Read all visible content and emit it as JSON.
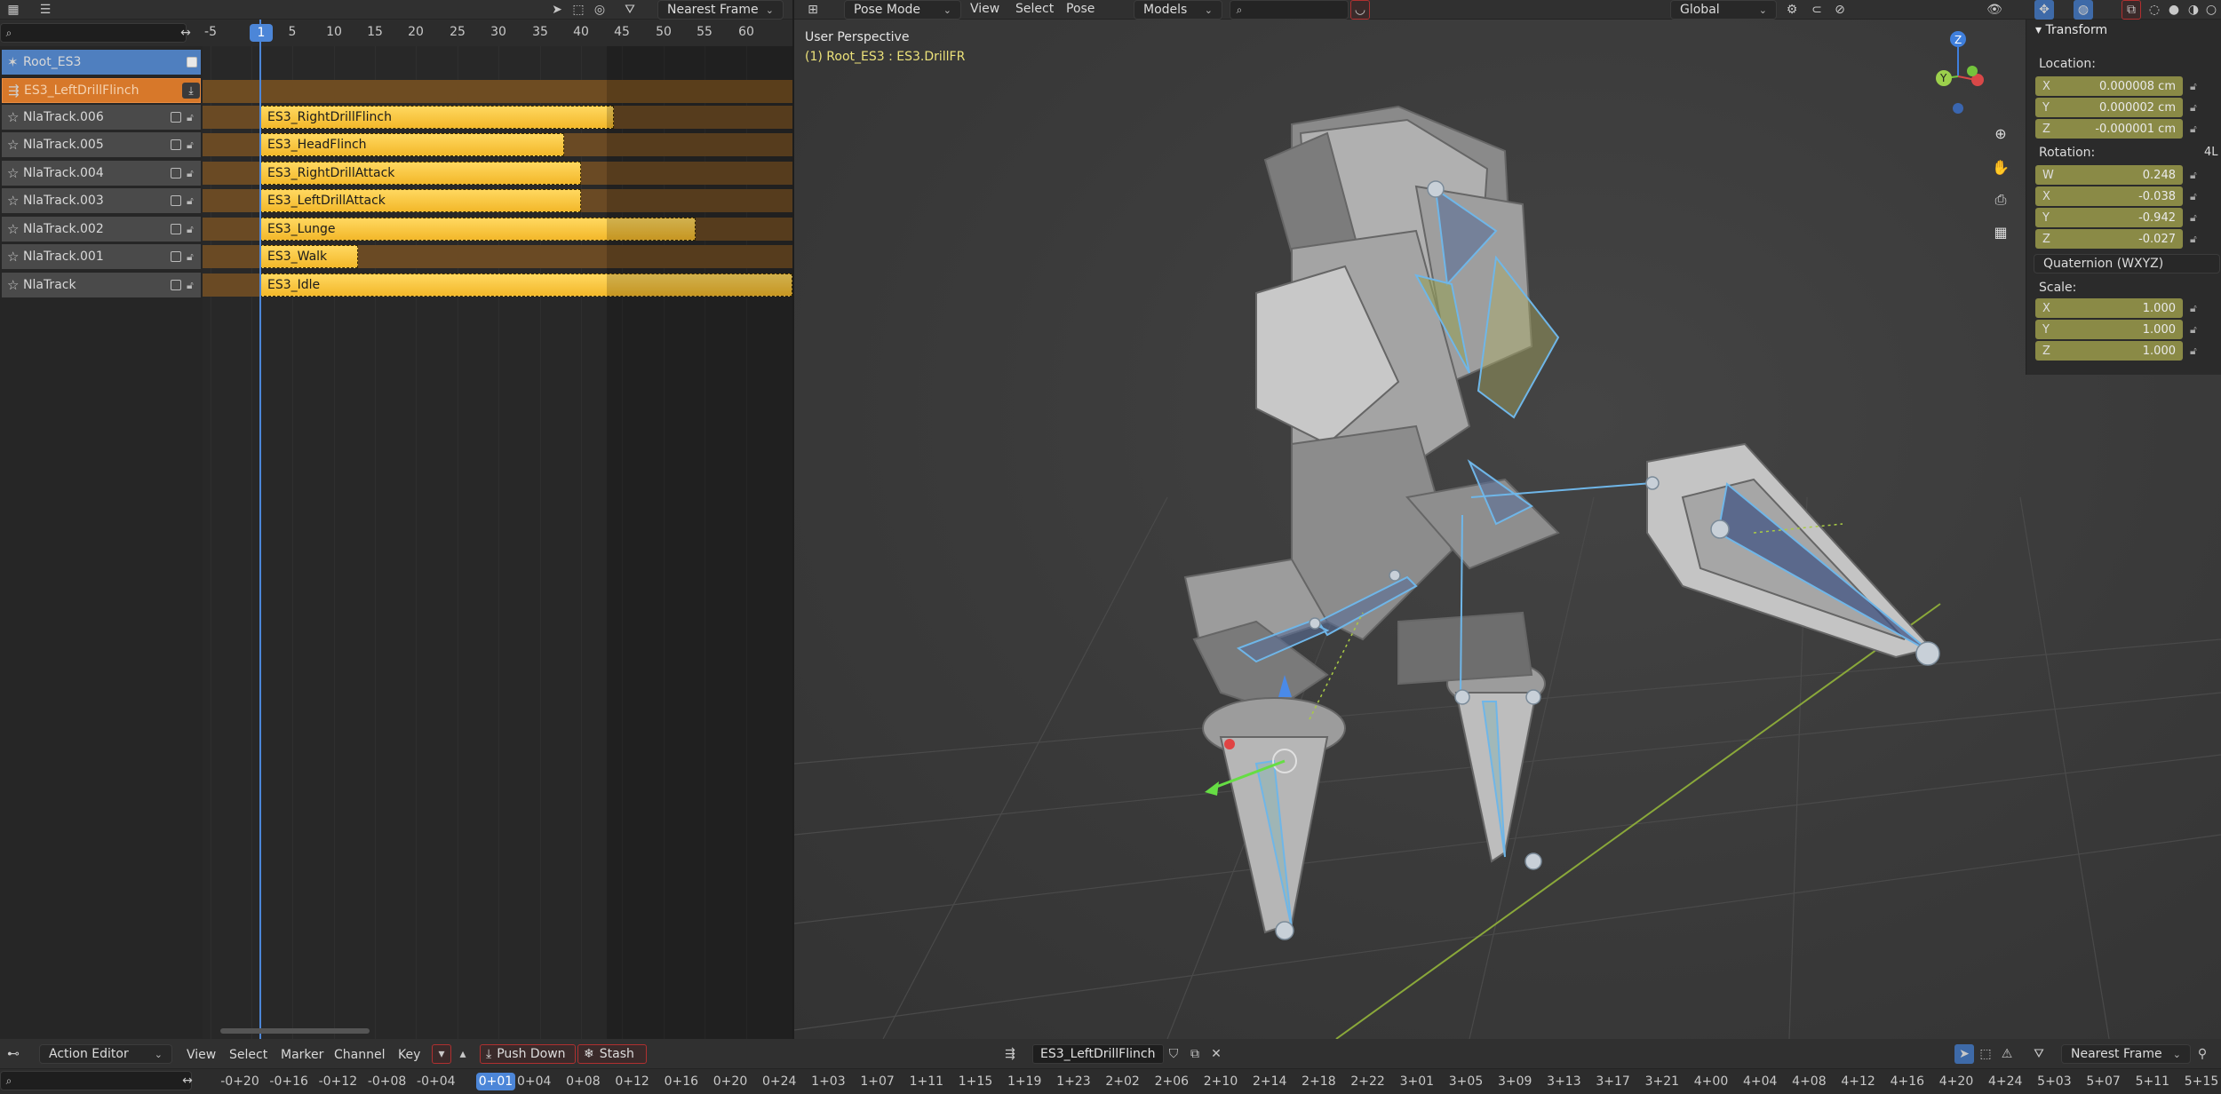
{
  "nla": {
    "snap_mode": "Nearest Frame",
    "ruler_ticks": [
      "-5",
      "1",
      "5",
      "10",
      "15",
      "20",
      "25",
      "30",
      "35",
      "40",
      "45",
      "50",
      "55",
      "60"
    ],
    "current_frame": "1",
    "object": "Root_ES3",
    "active_action": "ES3_LeftDrillFlinch",
    "tracks": [
      {
        "name": "NlaTrack.006",
        "strip": "ES3_RightDrillFlinch",
        "start": 1,
        "end": 43
      },
      {
        "name": "NlaTrack.005",
        "strip": "ES3_HeadFlinch",
        "start": 1,
        "end": 37
      },
      {
        "name": "NlaTrack.004",
        "strip": "ES3_RightDrillAttack",
        "start": 1,
        "end": 39
      },
      {
        "name": "NlaTrack.003",
        "strip": "ES3_LeftDrillAttack",
        "start": 1,
        "end": 39
      },
      {
        "name": "NlaTrack.002",
        "strip": "ES3_Lunge",
        "start": 1,
        "end": 53
      },
      {
        "name": "NlaTrack.001",
        "strip": "ES3_Walk",
        "start": 1,
        "end": 12
      },
      {
        "name": "NlaTrack",
        "strip": "ES3_Idle",
        "start": 1,
        "end": 68
      }
    ]
  },
  "viewport": {
    "mode": "Pose Mode",
    "menus": [
      "View",
      "Select",
      "Pose"
    ],
    "collection": "Models",
    "transform_orientation": "Global",
    "perspective_label": "User Perspective",
    "object_label": "(1) Root_ES3 : ES3.DrillFR",
    "axis_labels": {
      "z": "Z",
      "y": "Y"
    }
  },
  "transform": {
    "title": "Transform",
    "location_label": "Location:",
    "location": [
      {
        "axis": "X",
        "value": "0.000008 cm"
      },
      {
        "axis": "Y",
        "value": "0.000002 cm"
      },
      {
        "axis": "Z",
        "value": "-0.000001 cm"
      }
    ],
    "rotation_label": "Rotation:",
    "rotation_mode_hint": "4L",
    "rotation": [
      {
        "axis": "W",
        "value": "0.248"
      },
      {
        "axis": "X",
        "value": "-0.038"
      },
      {
        "axis": "Y",
        "value": "-0.942"
      },
      {
        "axis": "Z",
        "value": "-0.027"
      }
    ],
    "rotation_mode": "Quaternion (WXYZ)",
    "scale_label": "Scale:",
    "scale": [
      {
        "axis": "X",
        "value": "1.000"
      },
      {
        "axis": "Y",
        "value": "1.000"
      },
      {
        "axis": "Z",
        "value": "1.000"
      }
    ]
  },
  "action_editor": {
    "mode": "Action Editor",
    "menus": [
      "View",
      "Select",
      "Marker",
      "Channel",
      "Key"
    ],
    "push_down": "Push Down",
    "stash": "Stash",
    "action_name": "ES3_LeftDrillFlinch",
    "snap_mode": "Nearest Frame",
    "current": "0+01",
    "ruler_ticks": [
      "-0+20",
      "-0+16",
      "-0+12",
      "-0+08",
      "-0+04",
      "0",
      "0+04",
      "0+08",
      "0+12",
      "0+16",
      "0+20",
      "0+24",
      "1+03",
      "1+07",
      "1+11",
      "1+15",
      "1+19",
      "1+23",
      "2+02",
      "2+06",
      "2+10",
      "2+14",
      "2+18",
      "2+22",
      "3+01",
      "3+05",
      "3+09",
      "3+13",
      "3+17",
      "3+21",
      "4+00",
      "4+04",
      "4+08",
      "4+12",
      "4+16",
      "4+20",
      "4+24",
      "5+03",
      "5+07",
      "5+11",
      "5+15"
    ]
  },
  "colors": {
    "strip": "#f6c43a",
    "track_bg": "#6a4a24",
    "active_action_bg": "#d7782a",
    "object_row_bg": "#4f7fbf",
    "playhead": "#4c86d8",
    "field_bg": "#8a8a46",
    "bone_outline": "#6fb6e8"
  }
}
